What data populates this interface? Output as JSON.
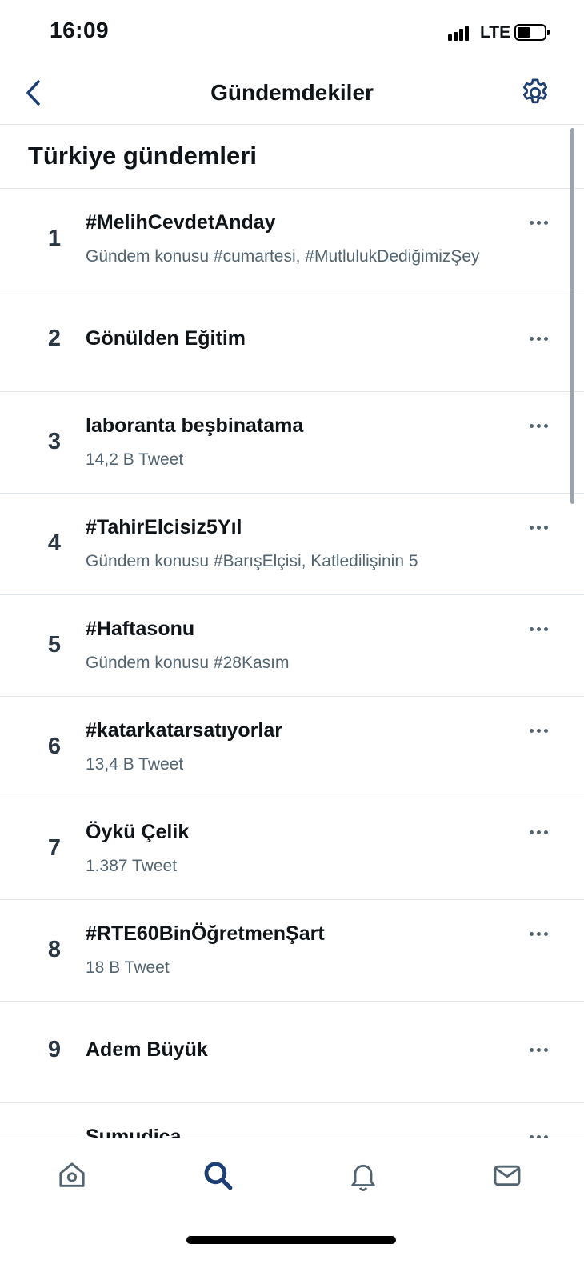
{
  "status_bar": {
    "time": "16:09",
    "network": "LTE"
  },
  "header": {
    "back_icon": "chevron-left-icon",
    "title": "Gündemdekiler",
    "settings_icon": "gear-icon"
  },
  "section": {
    "title": "Türkiye gündemleri"
  },
  "trends": [
    {
      "rank": "1",
      "name": "#MelihCevdetAnday",
      "meta": "Gündem konusu #cumartesi, #MutlulukDediğimizŞey"
    },
    {
      "rank": "2",
      "name": "Gönülden Eğitim"
    },
    {
      "rank": "3",
      "name": "laboranta beşbinatama",
      "meta": "14,2 B Tweet"
    },
    {
      "rank": "4",
      "name": "#TahirElcisiz5Yıl",
      "meta": "Gündem konusu #BarışElçisi, Katledilişinin 5"
    },
    {
      "rank": "5",
      "name": "#Haftasonu",
      "meta": "Gündem konusu #28Kasım"
    },
    {
      "rank": "6",
      "name": "#katarkatarsatıyorlar",
      "meta": "13,4 B Tweet"
    },
    {
      "rank": "7",
      "name": "Öykü Çelik",
      "meta": "1.387 Tweet"
    },
    {
      "rank": "8",
      "name": "#RTE60BinÖğretmenŞart",
      "meta": "18 B Tweet"
    },
    {
      "rank": "9",
      "name": "Adem Büyük"
    },
    {
      "rank": "",
      "name": "Sumudica"
    }
  ],
  "tab_bar": {
    "tabs": [
      {
        "icon": "home-icon",
        "active": false
      },
      {
        "icon": "search-icon",
        "active": true
      },
      {
        "icon": "bell-icon",
        "active": false
      },
      {
        "icon": "mail-icon",
        "active": false
      }
    ]
  },
  "colors": {
    "accent": "#1d3f73",
    "text_primary": "#0f1419",
    "text_secondary": "#536471",
    "divider": "#e1e6ea"
  }
}
